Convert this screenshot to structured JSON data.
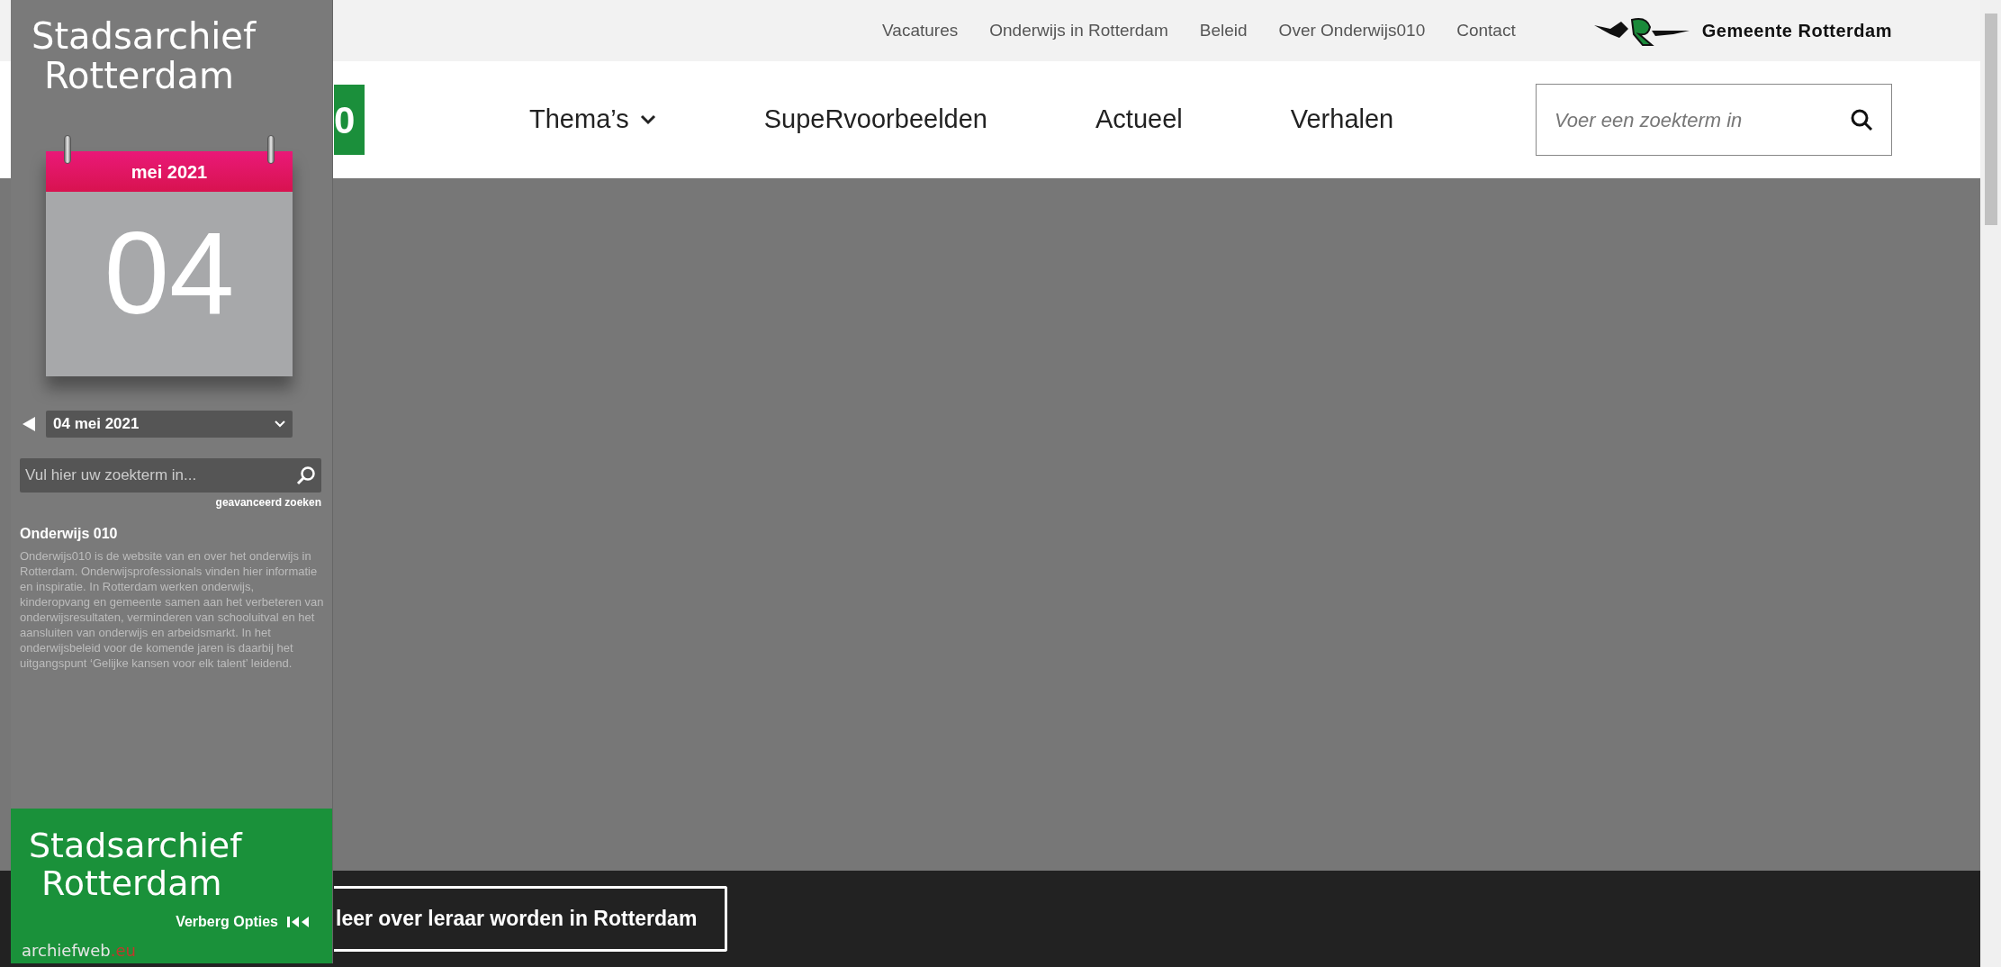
{
  "site": {
    "top_links": [
      "Vacatures",
      "Onderwijs in Rotterdam",
      "Beleid",
      "Over Onderwijs010",
      "Contact"
    ],
    "municipality": "Gemeente Rotterdam",
    "logo": "0",
    "nav": [
      {
        "label": "Thema’s",
        "dropdown": true
      },
      {
        "label": "SupeRvoorbeelden",
        "dropdown": false
      },
      {
        "label": "Actueel",
        "dropdown": false
      },
      {
        "label": "Verhalen",
        "dropdown": false
      }
    ],
    "search": {
      "placeholder": "Voer een zoekterm in"
    },
    "cta": "leer over leraar worden in Rotterdam"
  },
  "archive_panel": {
    "title_lines": [
      "Stadsarchief",
      "Rotterdam"
    ],
    "calendar": {
      "month": "mei 2021",
      "day": "04"
    },
    "date_select": "04 mei 2021",
    "search": {
      "placeholder": "Vul hier uw zoekterm in..."
    },
    "advanced_search": "geavanceerd zoeken",
    "heading": "Onderwijs 010",
    "description": "Onderwijs010 is de website van en over het onderwijs in Rotterdam. Onderwijsprofessionals vinden hier informatie en inspiratie. In Rotterdam werken onderwijs, kinderopvang en gemeente samen aan het verbeteren van onderwijsresultaten, verminderen van schooluitval en het aansluiten van onderwijs en arbeidsmarkt. In het onderwijsbeleid voor de komende jaren is daarbij het uitgangspunt ‘Gelijke kansen voor elk talent’ leidend.",
    "footer_title_lines": [
      "Stadsarchief",
      "Rotterdam"
    ],
    "hide_options": "Verberg Opties",
    "brand": {
      "name": "archiefweb",
      "suffix": ".eu"
    }
  }
}
